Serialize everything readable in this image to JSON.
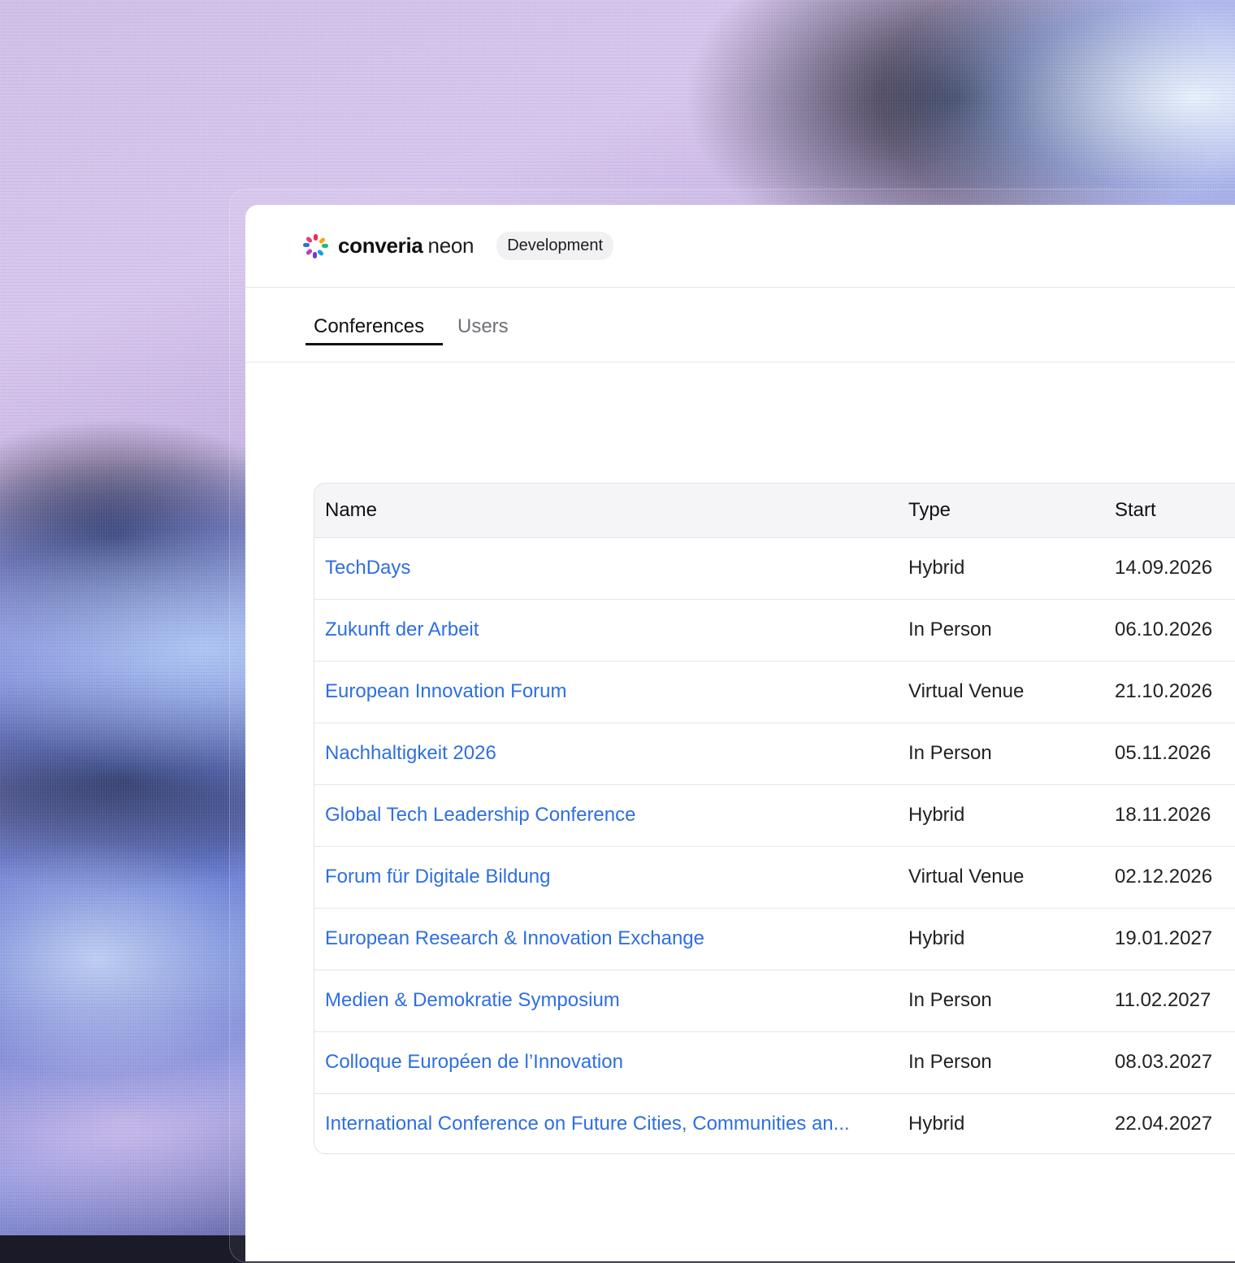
{
  "app": {
    "brand_primary": "converia",
    "brand_secondary": "neon",
    "environment": "Development",
    "accent_color": "#2f6fe0"
  },
  "tabs": [
    {
      "label": "Conferences",
      "active": true
    },
    {
      "label": "Users",
      "active": false
    }
  ],
  "table": {
    "headers": {
      "name": "Name",
      "type": "Type",
      "start": "Start"
    },
    "rows": [
      {
        "name": "TechDays",
        "type": "Hybrid",
        "start": "14.09.2026"
      },
      {
        "name": "Zukunft der Arbeit",
        "type": "In Person",
        "start": "06.10.2026"
      },
      {
        "name": "European Innovation Forum",
        "type": "Virtual Venue",
        "start": "21.10.2026"
      },
      {
        "name": "Nachhaltigkeit 2026",
        "type": "In Person",
        "start": "05.11.2026"
      },
      {
        "name": "Global Tech Leadership Conference",
        "type": "Hybrid",
        "start": "18.11.2026"
      },
      {
        "name": "Forum für Digitale Bildung",
        "type": "Virtual Venue",
        "start": "02.12.2026"
      },
      {
        "name": "European Research & Innovation Exchange",
        "type": "Hybrid",
        "start": "19.01.2027"
      },
      {
        "name": "Medien & Demokratie Symposium",
        "type": "In Person",
        "start": "11.02.2027"
      },
      {
        "name": "Colloque Européen de l’Innovation",
        "type": "In Person",
        "start": "08.03.2027"
      },
      {
        "name": "International Conference on Future Cities, Communities an...",
        "type": "Hybrid",
        "start": "22.04.2027"
      }
    ]
  }
}
